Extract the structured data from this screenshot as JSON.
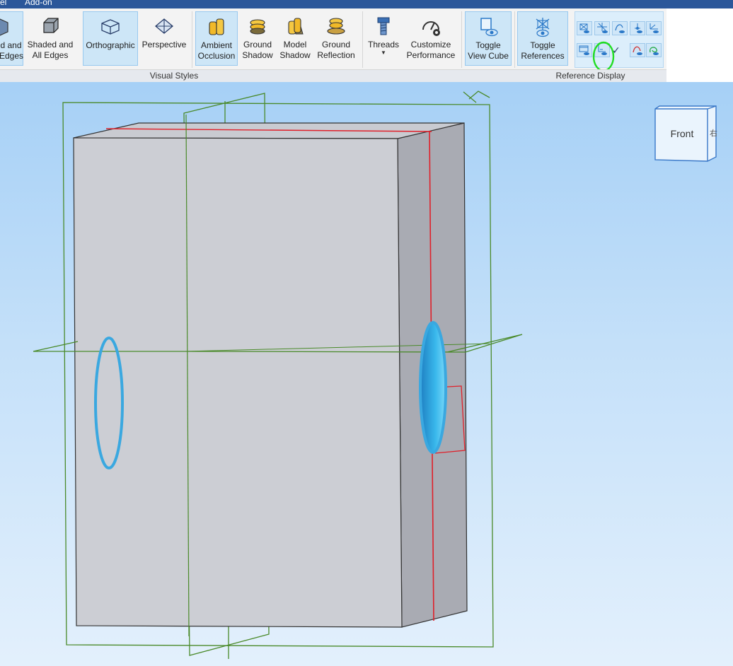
{
  "menubar": {
    "item_left": "el",
    "item_addon": "Add-on"
  },
  "ribbon": {
    "groups": {
      "visual_styles": "Visual Styles",
      "reference_display": "Reference Display"
    },
    "buttons": {
      "shaded_edges": [
        "d and",
        "Edges"
      ],
      "shaded_all_edges": [
        "Shaded and",
        "All Edges"
      ],
      "orthographic": [
        "Orthographic"
      ],
      "perspective": [
        "Perspective"
      ],
      "ambient_occlusion": [
        "Ambient",
        "Occlusion"
      ],
      "ground_shadow": [
        "Ground",
        "Shadow"
      ],
      "model_shadow": [
        "Model",
        "Shadow"
      ],
      "ground_reflection": [
        "Ground",
        "Reflection"
      ],
      "threads": [
        "Threads"
      ],
      "customize_performance": [
        "Customize",
        "Performance"
      ],
      "toggle_view_cube": [
        "Toggle",
        "View Cube"
      ],
      "toggle_references": [
        "Toggle",
        "References"
      ]
    }
  },
  "viewcube": {
    "face_label": "Front",
    "side_label": "右"
  },
  "colors": {
    "accent": "#2b579a",
    "active_button": "#cde6f7",
    "reference_plane": "#4a8a2a",
    "hole_highlight": "#3aa8e0",
    "edge_red": "#e0202a",
    "annotation_circle": "#22dd22"
  }
}
